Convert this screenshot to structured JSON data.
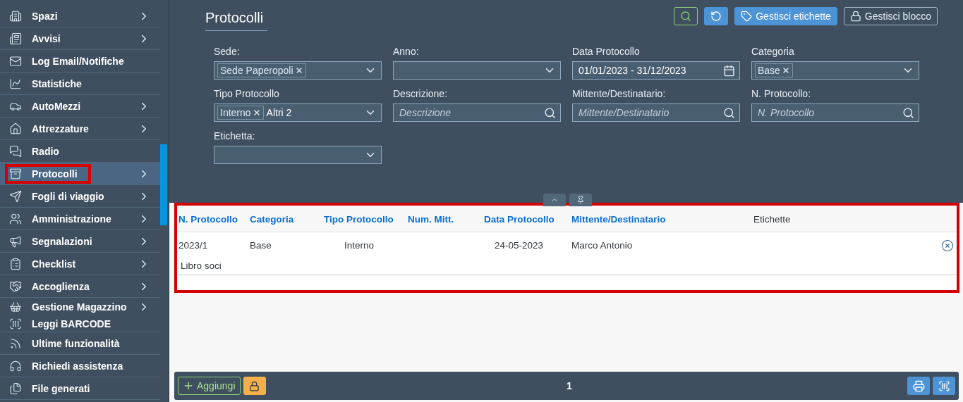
{
  "sidebar": {
    "items": [
      {
        "label": "Spazi",
        "has_submenu": true,
        "selected": false,
        "highlighted": false
      },
      {
        "label": "Avvisi",
        "has_submenu": true,
        "selected": false,
        "highlighted": false
      },
      {
        "label": "Log Email/Notifiche",
        "has_submenu": false,
        "selected": false,
        "highlighted": false
      },
      {
        "label": "Statistiche",
        "has_submenu": false,
        "selected": false,
        "highlighted": false
      },
      {
        "label": "AutoMezzi",
        "has_submenu": true,
        "selected": false,
        "highlighted": false
      },
      {
        "label": "Attrezzature",
        "has_submenu": true,
        "selected": false,
        "highlighted": false
      },
      {
        "label": "Radio",
        "has_submenu": false,
        "selected": false,
        "highlighted": false
      },
      {
        "label": "Protocolli",
        "has_submenu": true,
        "selected": true,
        "highlighted": true
      },
      {
        "label": "Fogli di viaggio",
        "has_submenu": true,
        "selected": false,
        "highlighted": false
      },
      {
        "label": "Amministrazione",
        "has_submenu": true,
        "selected": false,
        "highlighted": false
      },
      {
        "label": "Segnalazioni",
        "has_submenu": true,
        "selected": false,
        "highlighted": false
      },
      {
        "label": "Checklist",
        "has_submenu": true,
        "selected": false,
        "highlighted": false
      },
      {
        "label": "Accoglienza",
        "has_submenu": true,
        "selected": false,
        "highlighted": false
      },
      {
        "label": "Gestione Magazzino",
        "has_submenu": true,
        "selected": false,
        "highlighted": false
      },
      {
        "label": "Leggi BARCODE",
        "has_submenu": false,
        "selected": false,
        "highlighted": false
      },
      {
        "label": "Ultime funzionalità",
        "has_submenu": false,
        "selected": false,
        "highlighted": false
      },
      {
        "label": "Richiedi assistenza",
        "has_submenu": false,
        "selected": false,
        "highlighted": false
      },
      {
        "label": "File generati",
        "has_submenu": false,
        "selected": false,
        "highlighted": false
      }
    ]
  },
  "page": {
    "title": "Protocolli"
  },
  "toolbar": [
    {
      "kind": "search"
    },
    {
      "kind": "clear"
    },
    {
      "kind": "labels",
      "label": "Gestisci etichette"
    },
    {
      "kind": "lock",
      "label": "Gestisci blocco"
    }
  ],
  "filters": [
    {
      "label": "Sede:",
      "kind": "select",
      "tokens": [
        "Sede Paperopoli"
      ]
    },
    {
      "label": "Anno:",
      "kind": "select"
    },
    {
      "label": "Data Protocollo",
      "kind": "date",
      "value": "01/01/2023 - 31/12/2023"
    },
    {
      "label": "Categoria",
      "kind": "select",
      "tokens": [
        "Base"
      ]
    },
    {
      "label": "Tipo Protocollo",
      "kind": "select",
      "tokens": [
        "Interno"
      ],
      "more": "Altri 2"
    },
    {
      "label": "Descrizione:",
      "kind": "search",
      "placeholder": "Descrizione"
    },
    {
      "label": "Mittente/Destinatario:",
      "kind": "search",
      "placeholder": "Mittente/Destinatario"
    },
    {
      "label": "N. Protocollo:",
      "kind": "search",
      "placeholder": "N. Protocollo"
    },
    {
      "label": "Etichetta:",
      "kind": "select"
    }
  ],
  "table": {
    "highlighted": true,
    "columns": [
      {
        "label": "N. Protocollo",
        "kind": "sortable"
      },
      {
        "label": "Categoria",
        "kind": "sortable"
      },
      {
        "label": "Tipo Protocollo",
        "kind": "sortable"
      },
      {
        "label": "Num. Mitt.",
        "kind": "sortable"
      },
      {
        "label": "Data Protocollo",
        "kind": "sortable"
      },
      {
        "label": "Mittente/Destinatario",
        "kind": "sortable"
      },
      {
        "label": "Etichette",
        "kind": "plain"
      }
    ],
    "rows": [
      {
        "cells": [
          "2023/1",
          "Base",
          "Interno",
          "",
          "24-05-2023",
          "Marco Antonio",
          ""
        ],
        "description": "Libro soci"
      }
    ]
  },
  "footer": {
    "add": "Aggiungi",
    "page": "1"
  }
}
